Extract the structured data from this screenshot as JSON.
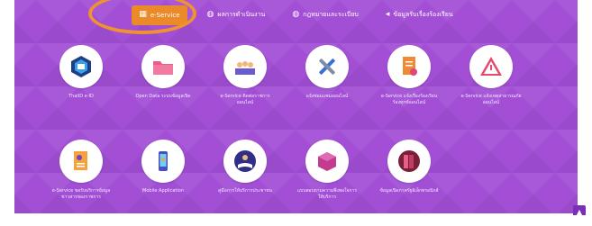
{
  "tabs": [
    {
      "icon": "grid-icon",
      "glyph": "▦",
      "label": "e-Service"
    },
    {
      "icon": "globe-icon",
      "glyph": "◍",
      "label": "ผลการดำเนินงาน"
    },
    {
      "icon": "globe-icon",
      "glyph": "◍",
      "label": "กฎหมายและระเบียบ"
    },
    {
      "icon": "megaphone-icon",
      "glyph": "◂",
      "label": "ข้อมูลรับเรื่องร้องเรียน"
    }
  ],
  "services": [
    {
      "icon": "badge-icon",
      "label": "ThaiID e-ID",
      "bg": "#ffffff"
    },
    {
      "icon": "folder-icon",
      "label": "Open Data ระบบข้อมูลเปิด",
      "bg": "#ffffff"
    },
    {
      "icon": "people-icon",
      "label": "e-Service ติดต่อราชการออนไลน์",
      "bg": "#ffffff"
    },
    {
      "icon": "tools-icon",
      "label": "แจ้งซ่อมแซมออนไลน์",
      "bg": "#ffffff"
    },
    {
      "icon": "document-icon",
      "label": "e-Service แจ้งเรื่องร้องเรียนร้องทุกข์ออนไลน์",
      "bg": "#ffffff"
    },
    {
      "icon": "warning-icon",
      "label": "e-Service แจ้งเหตุสาธารณภัยออนไลน์",
      "bg": "#ffffff"
    },
    {
      "icon": "form-icon",
      "label": "e-Service ขอรับบริการข้อมูลข่าวสารของราชการ",
      "bg": "#ffffff"
    },
    {
      "icon": "mobile-icon",
      "label": "Mobile Application",
      "bg": "#ffffff"
    },
    {
      "icon": "book-icon",
      "label": "คู่มือการให้บริการประชาชน",
      "bg": "#ffffff"
    },
    {
      "icon": "box-icon",
      "label": "แบบสอบถามความพึงพอใจการให้บริการ",
      "bg": "#ffffff"
    },
    {
      "icon": "binder-icon",
      "label": "ข้อมูลเปิดภาครัฐอิเล็กทรอนิกส์",
      "bg": "#ffffff"
    }
  ],
  "colors": {
    "accent": "#ec8a2a",
    "panel": "#a24fd6"
  }
}
